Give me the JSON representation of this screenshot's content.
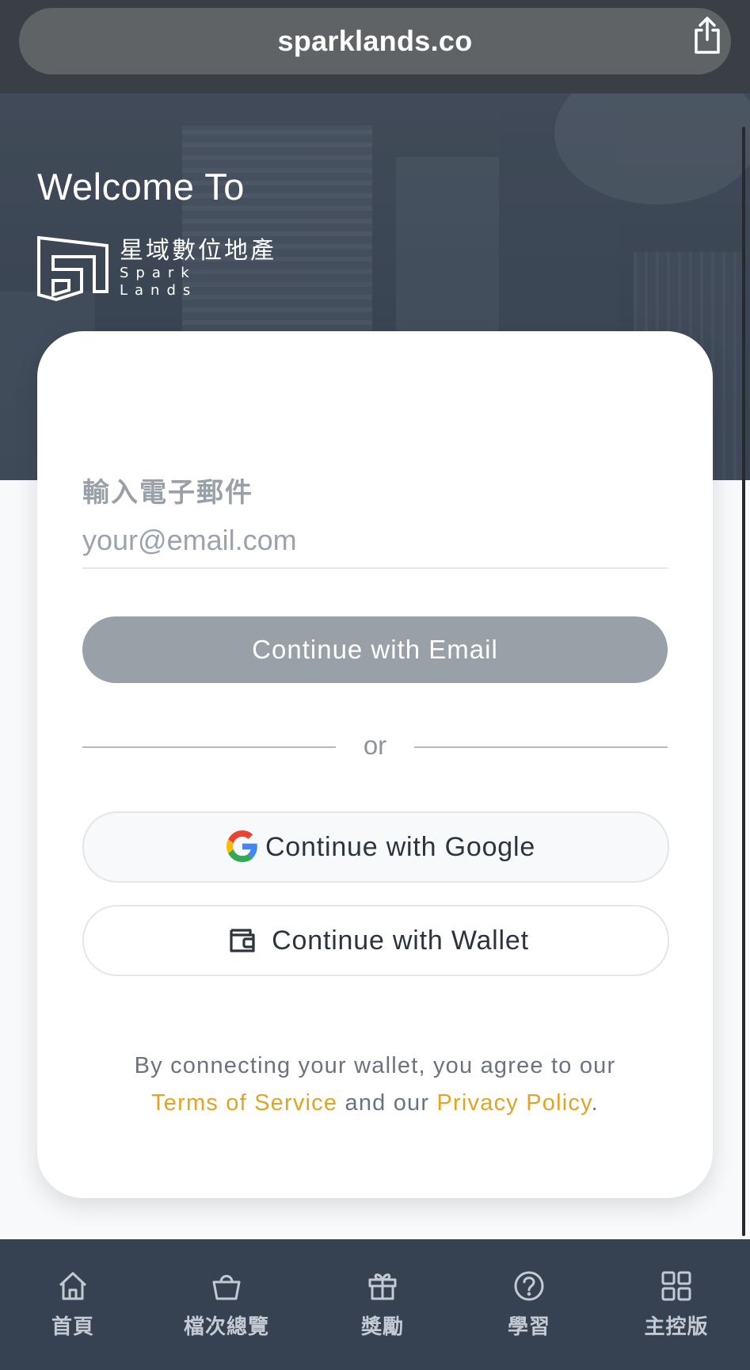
{
  "browser": {
    "url": "sparklands.co",
    "share_icon": "share-icon"
  },
  "hero": {
    "welcome": "Welcome To",
    "logo_cn": "星域數位地產",
    "logo_en": "Spark Lands"
  },
  "login": {
    "email_label": "輸入電子郵件",
    "email_placeholder": "your@email.com",
    "email_value": "",
    "continue_email": "Continue with Email",
    "or": "or",
    "continue_google": "Continue with Google",
    "continue_wallet": "Continue with Wallet",
    "legal_prefix": "By connecting your wallet, you agree to our",
    "terms": "Terms of Service",
    "and_our": "and our",
    "privacy": "Privacy Policy",
    "period": "."
  },
  "tabs": [
    {
      "label": "首頁",
      "icon": "home-icon"
    },
    {
      "label": "檔次總覽",
      "icon": "basket-icon"
    },
    {
      "label": "獎勵",
      "icon": "gift-icon"
    },
    {
      "label": "學習",
      "icon": "question-icon"
    },
    {
      "label": "主控版",
      "icon": "dashboard-grid-icon"
    }
  ],
  "colors": {
    "accent_link": "#e0a426",
    "tabbar_bg": "#364152",
    "email_button_bg": "#9aa0a8"
  }
}
